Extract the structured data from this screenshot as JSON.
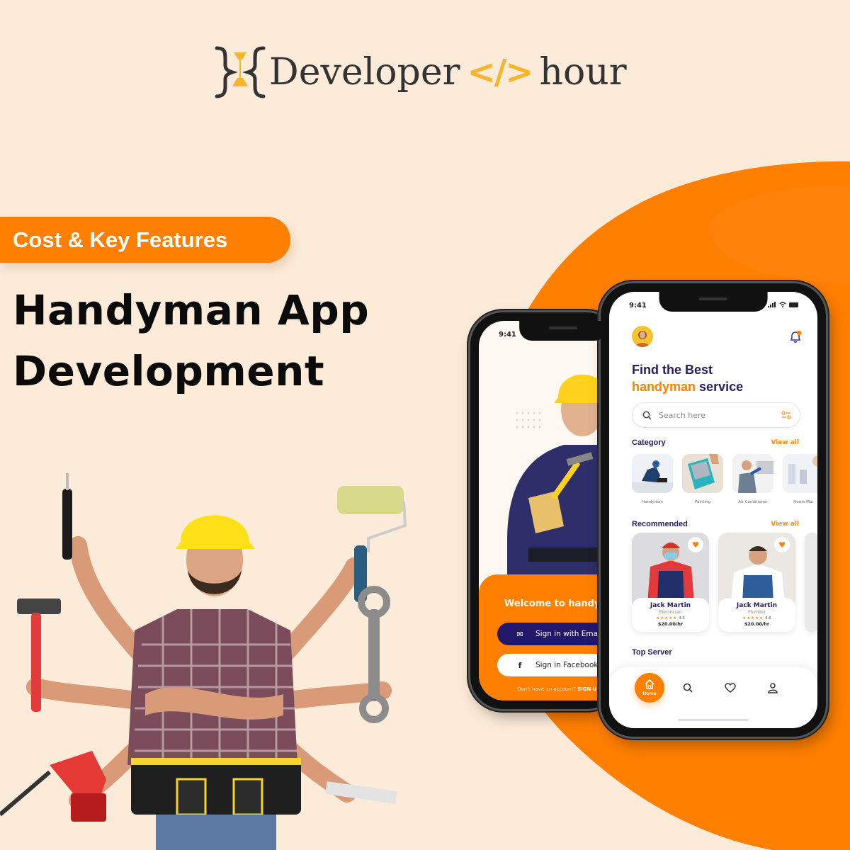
{
  "brand": {
    "name_primary": "Developer",
    "code_glyph": "</>",
    "name_secondary": "hour",
    "colors": {
      "text": "#333333",
      "accent": "#f7b52e"
    }
  },
  "badge": {
    "label": "Cost & Key Features",
    "color": "#ff7f00"
  },
  "headline": {
    "line1": "Handyman App",
    "line2": "Development"
  },
  "theme": {
    "background": "#fdebd9",
    "orange": "#ff7f00",
    "navy": "#27205f"
  },
  "phone_back": {
    "time": "9:41",
    "welcome": "Welcome to handyman",
    "email_button": "Sign in with Email",
    "facebook_button": "Sign in Facebook",
    "signup_prompt": "Don't have an account?",
    "signup_link": "SIGN UP"
  },
  "phone_front": {
    "time": "9:41",
    "title_line1": "Find the Best",
    "title_accent": "handyman",
    "title_rest": "service",
    "search_placeholder": "Search here",
    "category": {
      "title": "Category",
      "view_all": "View all",
      "items": [
        {
          "label": "Handyman"
        },
        {
          "label": "Painting"
        },
        {
          "label": "Air Conditioner"
        },
        {
          "label": "Home Mai"
        }
      ]
    },
    "recommended": {
      "title": "Recommended",
      "view_all": "View all",
      "items": [
        {
          "name": "Jack Martin",
          "role": "Electrician",
          "stars": "★★★★★",
          "rating": "4.5",
          "price": "$20.00/hr"
        },
        {
          "name": "Jack Martin",
          "role": "Plumber",
          "stars": "★★★★★",
          "rating": "4.6",
          "price": "$20.00/hr"
        }
      ]
    },
    "top_server": {
      "title": "Top Server"
    },
    "nav": {
      "home_label": "Home"
    }
  }
}
